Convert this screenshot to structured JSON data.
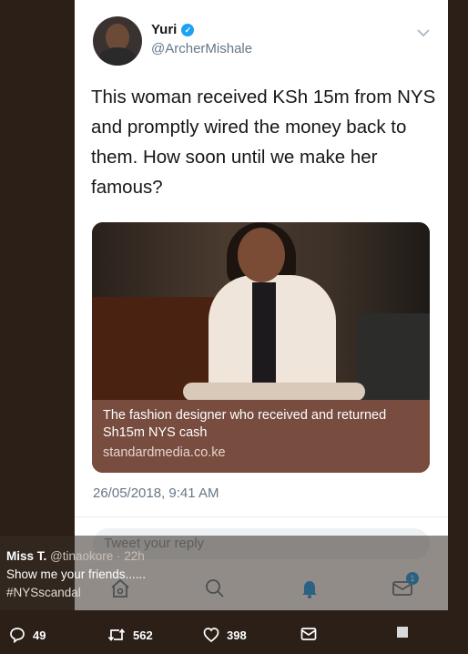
{
  "tweet": {
    "display_name": "Yuri",
    "verified_mark": "✓",
    "handle": "@ArcherMishale",
    "text": "This woman received KSh 15m from NYS and promptly wired the money back to them. How soon until we make her famous?",
    "card": {
      "title": "The fashion designer who received and returned Sh15m NYS cash",
      "domain": "standardmedia.co.ke"
    },
    "timestamp": "26/05/2018, 9:41 AM",
    "reply_placeholder": "Tweet your reply"
  },
  "nav": {
    "notification_badge": "1"
  },
  "overlay_tweet": {
    "user": "Miss T.",
    "handle": "@tinaokore",
    "time": "· 22h",
    "line1": "Show me your friends......",
    "hashtag": "#NYSscandal"
  },
  "actions": {
    "replies": "49",
    "retweets": "562",
    "likes": "398"
  },
  "colors": {
    "accent": "#1da1f2",
    "card_caption": "#784c3e",
    "background": "#2b1f17"
  }
}
